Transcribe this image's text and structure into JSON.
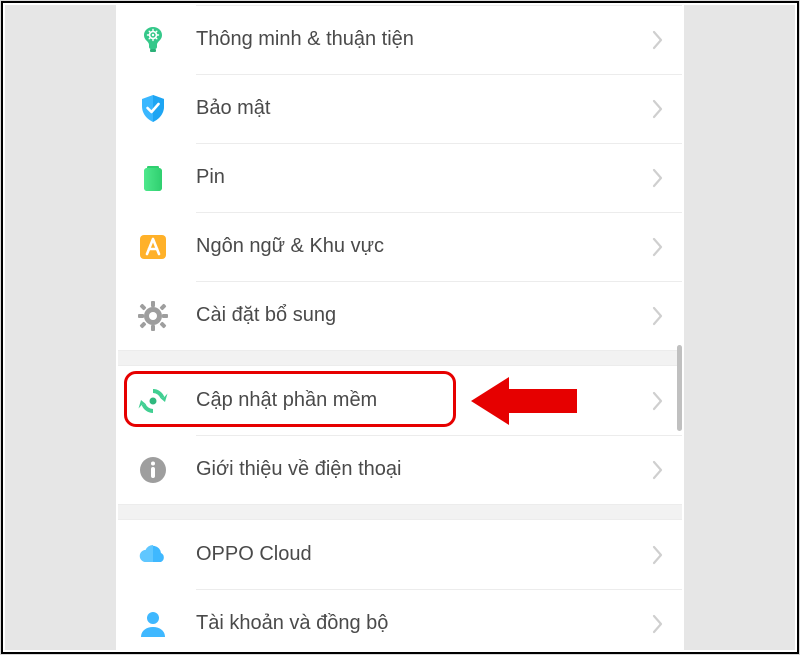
{
  "settings": {
    "groups": [
      {
        "items": [
          {
            "key": "smart",
            "label": "Thông minh & thuận tiện",
            "icon": "brain-icon"
          },
          {
            "key": "security",
            "label": "Bảo mật",
            "icon": "shield-icon"
          },
          {
            "key": "battery",
            "label": "Pin",
            "icon": "battery-icon"
          },
          {
            "key": "language",
            "label": "Ngôn ngữ & Khu vực",
            "icon": "language-icon"
          },
          {
            "key": "additional",
            "label": "Cài đặt bổ sung",
            "icon": "gear-icon"
          }
        ]
      },
      {
        "items": [
          {
            "key": "update",
            "label": "Cập nhật phần mềm",
            "icon": "update-icon",
            "highlighted": true
          },
          {
            "key": "about",
            "label": "Giới thiệu về điện thoại",
            "icon": "info-icon"
          }
        ]
      },
      {
        "items": [
          {
            "key": "cloud",
            "label": "OPPO Cloud",
            "icon": "cloud-icon"
          },
          {
            "key": "account",
            "label": "Tài khoản và đồng bộ",
            "icon": "user-icon"
          }
        ]
      }
    ]
  },
  "colors": {
    "highlight": "#e60000",
    "chevron": "#cfcfcf",
    "separator": "#ececec",
    "groupGap": "#f2f2f2"
  }
}
